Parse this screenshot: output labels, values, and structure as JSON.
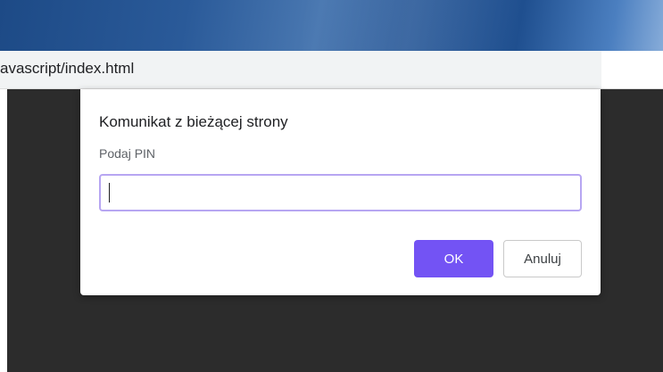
{
  "browser": {
    "address_text": "avascript/index.html"
  },
  "dialog": {
    "title": "Komunikat z bieżącej strony",
    "message": "Podaj PIN",
    "input_value": "",
    "ok_label": "OK",
    "cancel_label": "Anuluj"
  },
  "colors": {
    "accent": "#7353f4",
    "input_focus_border": "#b7a6f2",
    "page_background": "#2c2c2c",
    "titlebar": "#2a5a99"
  }
}
